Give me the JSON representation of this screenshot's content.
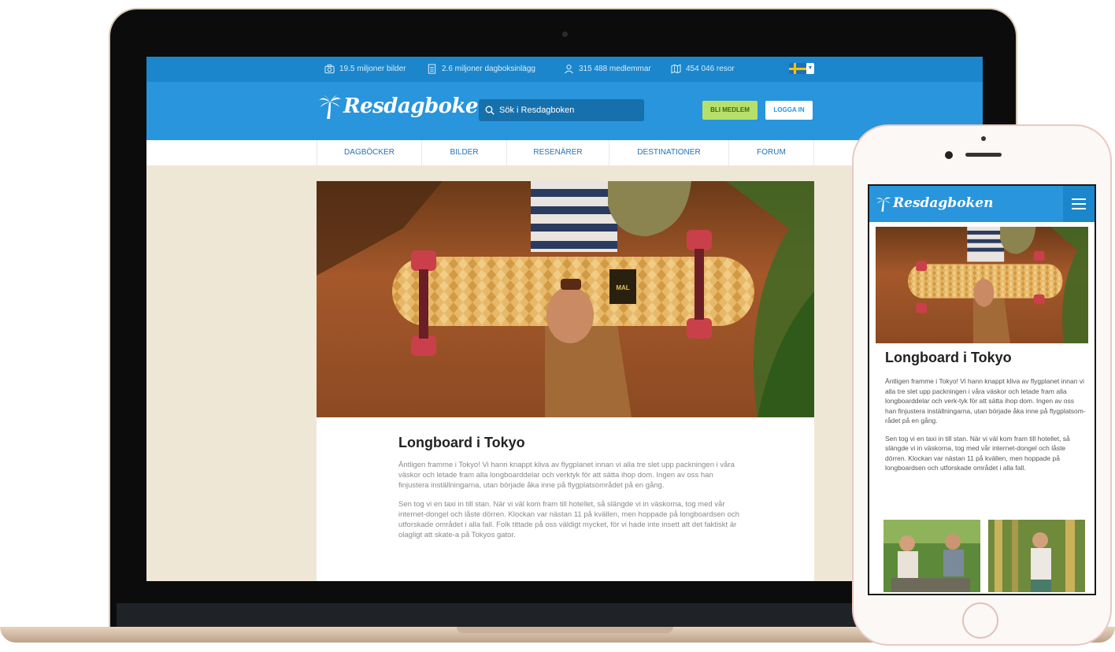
{
  "stats": [
    {
      "icon": "camera-icon",
      "label": "19.5 miljoner bilder"
    },
    {
      "icon": "document-icon",
      "label": "2.6 miljoner dagboksinlägg"
    },
    {
      "icon": "user-icon",
      "label": "315 488 medlemmar"
    },
    {
      "icon": "map-icon",
      "label": "454 046 resor"
    }
  ],
  "header": {
    "logo": "Resdagboken",
    "search_placeholder": "Sök i Resdagboken",
    "member_button": "BLI MEDLEM",
    "login_button": "LOGGA IN"
  },
  "nav": [
    "DAGBÖCKER",
    "BILDER",
    "RESENÄRER",
    "DESTINATIONER",
    "FORUM"
  ],
  "article": {
    "title": "Longboard i Tokyo",
    "paragraphs": [
      "Äntligen framme i Tokyo! Vi hann knappt kliva av flygplanet innan vi alla tre slet upp packningen i våra väskor och letade fram alla longboarddelar och verktyk för att sätta ihop dom. Ingen av oss han finjustera inställningarna, utan började åka inne på flygplatsområdet på en gång.",
      "Sen tog vi en taxi in till stan. När vi väl kom fram till hotellet, så slängde vi in väskorna, tog med vår internet-dongel och låste dörren. Klockan var nästan 11 på kvällen, men hoppade på longboardsen och utforskade området i alla fall. Folk tittade på oss väldigt mycket, för vi hade inte insett att det faktiskt är olagligt att skate-a på Tokyos gator."
    ]
  },
  "mobile": {
    "logo": "Resdagboken",
    "title": "Longboard i Tokyo",
    "paragraphs": [
      "Äntligen framme i Tokyo! Vi hann knappt kliva av flygplanet innan vi alla tre slet upp packningen i våra väskor och letade fram alla longboarddelar och verk-tyk för att sätta ihop dom. Ingen av oss han finjustera inställningarna, utan började åka inne på flygplatsom-rådet på en gång.",
      "Sen tog vi en taxi in till stan. När vi väl kom fram till hotellet, så slängde vi in väskorna, tog med vår internet-dongel och låste dörren. Klockan var nästan 11 på kvällen, men hoppade på longboardsen och utforskade området i alla fall."
    ]
  },
  "colors": {
    "brand_blue": "#2895dc",
    "stats_blue": "#1b86cb",
    "member_green": "#b7e06b",
    "page_beige": "#efe7d6"
  }
}
